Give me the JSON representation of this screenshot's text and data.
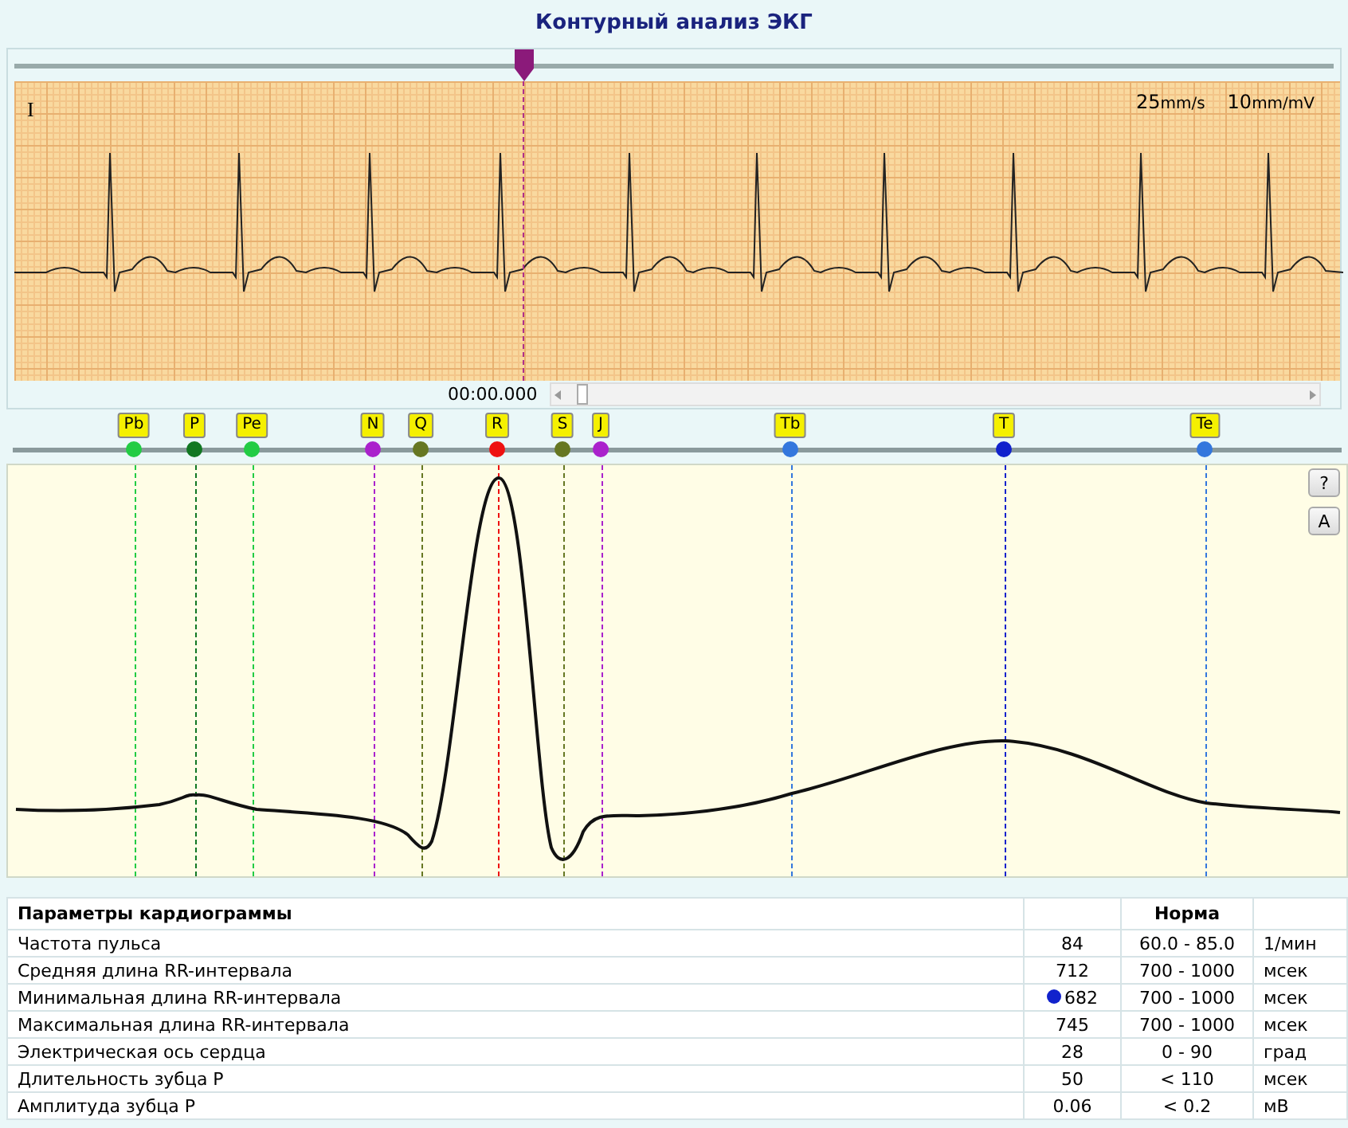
{
  "title": "Контурный анализ ЭКГ",
  "strip": {
    "lead": "I",
    "speed": {
      "value": "25",
      "unit": "mm/s"
    },
    "gain": {
      "value": "10",
      "unit": "mm/mV"
    },
    "time": "00:00.000"
  },
  "markers": [
    {
      "label": "Pb",
      "color": "#22cc44"
    },
    {
      "label": "P",
      "color": "#117722"
    },
    {
      "label": "Pe",
      "color": "#22cc44"
    },
    {
      "label": "N",
      "color": "#aa22cc"
    },
    {
      "label": "Q",
      "color": "#667722"
    },
    {
      "label": "R",
      "color": "#ee1111"
    },
    {
      "label": "S",
      "color": "#667722"
    },
    {
      "label": "J",
      "color": "#aa22cc"
    },
    {
      "label": "Tb",
      "color": "#3377dd"
    },
    {
      "label": "T",
      "color": "#1122cc"
    },
    {
      "label": "Te",
      "color": "#3377dd"
    }
  ],
  "side_buttons": [
    "?",
    "A"
  ],
  "table": {
    "columns": [
      "Параметры кардиограммы",
      "Норма"
    ],
    "rows": [
      {
        "name": "Частота пульса",
        "value": "84",
        "norm": "60.0 - 85.0",
        "unit": "1/мин",
        "flagged": false
      },
      {
        "name": "Средняя длина RR-интервала",
        "value": "712",
        "norm": "700 - 1000",
        "unit": "мсек",
        "flagged": false
      },
      {
        "name": "Минимальная длина RR-интервала",
        "value": "682",
        "norm": "700 - 1000",
        "unit": "мсек",
        "flagged": true
      },
      {
        "name": "Максимальная длина RR-интервала",
        "value": "745",
        "norm": "700 - 1000",
        "unit": "мсек",
        "flagged": false
      },
      {
        "name": "Электрическая ось сердца",
        "value": "28",
        "norm": "0 - 90",
        "unit": "град",
        "flagged": false
      },
      {
        "name": "Длительность зубца P",
        "value": "50",
        "norm": "< 110",
        "unit": "мсек",
        "flagged": false
      },
      {
        "name": "Амплитуда зубца P",
        "value": "0.06",
        "norm": "< 0.2",
        "unit": "мВ",
        "flagged": false
      }
    ]
  }
}
